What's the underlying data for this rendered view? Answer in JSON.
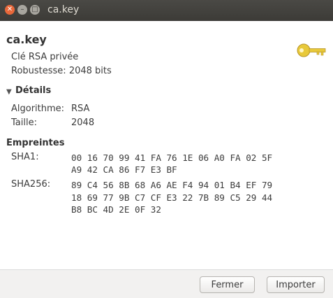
{
  "window": {
    "title": "ca.key"
  },
  "header": {
    "title": "ca.key",
    "type": "Clé RSA privée",
    "strength": "Robustesse: 2048 bits"
  },
  "details": {
    "heading": "Détails",
    "algorithm_label": "Algorithme:",
    "algorithm_value": "RSA",
    "size_label": "Taille:",
    "size_value": "2048"
  },
  "fingerprints": {
    "heading": "Empreintes",
    "sha1_label": "SHA1:",
    "sha1_lines": [
      "00 16 70 99 41 FA 76 1E 06 A0 FA 02 5F",
      "A9 42 CA 86 F7 E3 BF"
    ],
    "sha256_label": "SHA256:",
    "sha256_lines": [
      "89 C4 56 8B 68 A6 AE F4 94 01 B4 EF 79",
      "18 69 77 9B C7 CF E3 22 7B 89 C5 29 44",
      "B8 BC 4D 2E 0F 32"
    ]
  },
  "buttons": {
    "close": "Fermer",
    "import": "Importer"
  },
  "colors": {
    "titlebar": "#3c3b37",
    "close_button": "#e9683a",
    "key_icon": "#e8c93a"
  },
  "icons": {
    "close": "close-icon",
    "minimize": "minimize-icon",
    "maximize": "maximize-icon",
    "key": "key-icon",
    "expander": "triangle-down-icon"
  }
}
